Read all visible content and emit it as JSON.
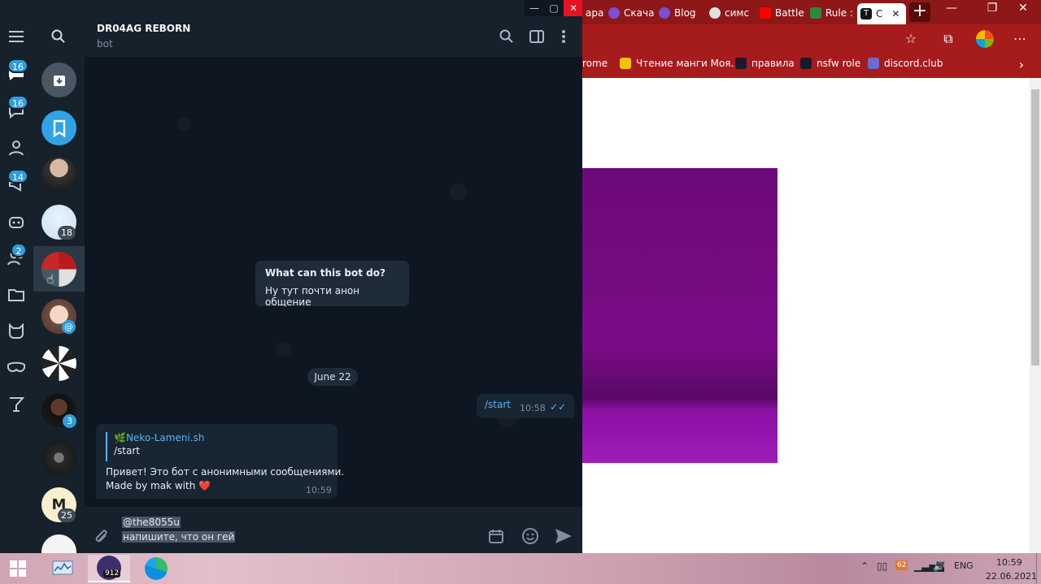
{
  "browser": {
    "tabs": [
      {
        "label": "ара",
        "color": "#c0392b"
      },
      {
        "label": "Скача",
        "color": "#7b4fd6"
      },
      {
        "label": "Blog",
        "color": "#7b4fd6"
      },
      {
        "label": "симс",
        "color": "#e0e0e0"
      },
      {
        "label": "Battle",
        "color": "#ff0000"
      },
      {
        "label": "Rule :",
        "color": "#2b8a3e"
      },
      {
        "label": "С",
        "color": "#111111"
      }
    ],
    "new_tab": "+",
    "bookmarks": [
      {
        "label": "rome",
        "color": "#a61b1b"
      },
      {
        "label": "Чтение манги Моя...",
        "color": "#f2c200"
      },
      {
        "label": "правила",
        "color": "#1a1a2e"
      },
      {
        "label": "nsfw role",
        "color": "#1a1a2e"
      },
      {
        "label": "discord.club",
        "color": "#6b6bd6"
      }
    ],
    "accent": "#a61b1b"
  },
  "telegram": {
    "header": {
      "title": "DR04AG REBORN",
      "subtitle": "bot"
    },
    "folder_badges": [
      "16",
      "16",
      "14",
      "2"
    ],
    "chat_badges": [
      "18",
      "@",
      "3",
      "25"
    ],
    "bot_info": {
      "title": "What can this bot do?",
      "text": "Ну тут почти анон общение"
    },
    "date_separator": "June 22",
    "outgoing": {
      "text": "/start",
      "time": "10:58"
    },
    "incoming": {
      "reply_name": "🌿Neko-Lameni.sh",
      "reply_text": "/start",
      "line1": "Привет! Это бот с анонимными сообщениями.",
      "line2": "Made by mak with",
      "heart": "❤️",
      "time": "10:59"
    },
    "composer": {
      "line1": "@the8055u",
      "line2": "напишите, что он гей"
    }
  },
  "taskbar": {
    "tray_lang": "ENG",
    "tray_badge": "62",
    "clock_time": "10:59",
    "clock_date": "22.06.2021",
    "app_badge": "912"
  }
}
